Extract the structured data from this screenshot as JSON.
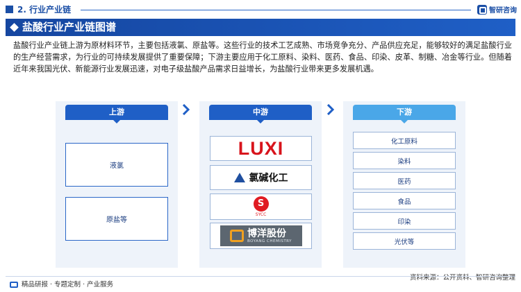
{
  "header": {
    "section_title": "2. 行业产业链",
    "brand": "智研咨询"
  },
  "title_bar": {
    "title": "盐酸行业产业链图谱"
  },
  "intro_text": "盐酸行业产业链上游为原材料环节，主要包括液氯、原盐等。这些行业的技术工艺成熟、市场竞争充分、产品供应充足，能够较好的满足盐酸行业的生产经营需求，为行业的可持续发展提供了重要保障；下游主要应用于化工原料、染料、医药、食品、印染、皮革、制糖、冶金等行业。但随着近年来我国光伏、新能源行业发展迅速，对电子级盐酸产品需求日益增长，为盐酸行业带来更多发展机遇。",
  "upstream": {
    "label": "上游",
    "items": [
      "液氯",
      "原盐等"
    ]
  },
  "midstream": {
    "label": "中游",
    "logos": {
      "luxi": "LUXI",
      "chlor_alkali": "氯碱化工",
      "sycc_mark": "S",
      "sycc_text": "SYCC",
      "boyang": "博洋股份",
      "boyang_sub": "BOYANG CHEMISTRY"
    }
  },
  "downstream": {
    "label": "下游",
    "items": [
      "化工原料",
      "染料",
      "医药",
      "食品",
      "印染",
      "光伏等"
    ]
  },
  "footer": {
    "left": "精品研报 · 专题定制 · 产业服务",
    "source": "资料来源：公开资料、智研咨询整理"
  },
  "colors": {
    "primary": "#1f5fc6",
    "dark_blue": "#1546a0",
    "light_blue": "#4aa7e8",
    "panel_bg": "#eef3fa",
    "luxi_red": "#d8141c"
  }
}
